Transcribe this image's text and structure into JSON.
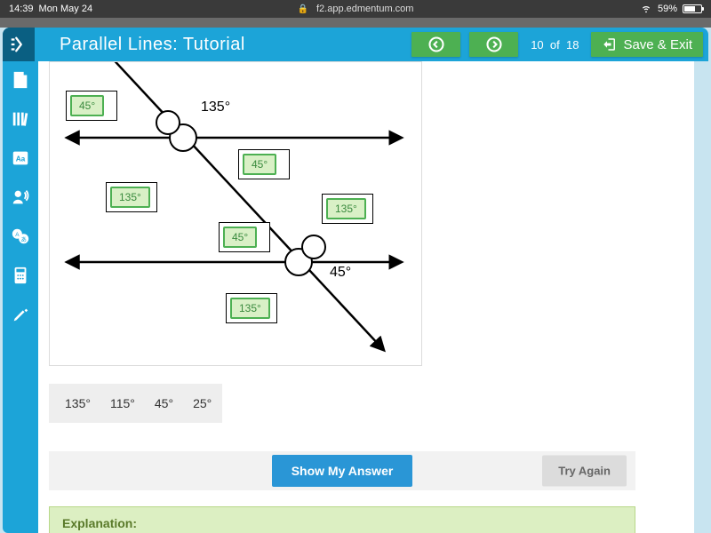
{
  "status": {
    "time": "14:39",
    "day": "Mon May 24",
    "url": "f2.app.edmentum.com",
    "battery_pct": "59%"
  },
  "header": {
    "title": "Parallel Lines: Tutorial",
    "page_current": "10",
    "page_sep": "of",
    "page_total": "18",
    "save_exit": "Save & Exit"
  },
  "diagram": {
    "label_135_top": "135°",
    "label_45_bottom": "45°",
    "chips": {
      "a": "45°",
      "b": "45°",
      "c": "135°",
      "d": "45°",
      "e": "135°",
      "f": "135°"
    }
  },
  "bank": {
    "o1": "135°",
    "o2": "115°",
    "o3": "45°",
    "o4": "25°"
  },
  "actions": {
    "show": "Show My Answer",
    "try": "Try Again"
  },
  "explanation_label": "Explanation:"
}
